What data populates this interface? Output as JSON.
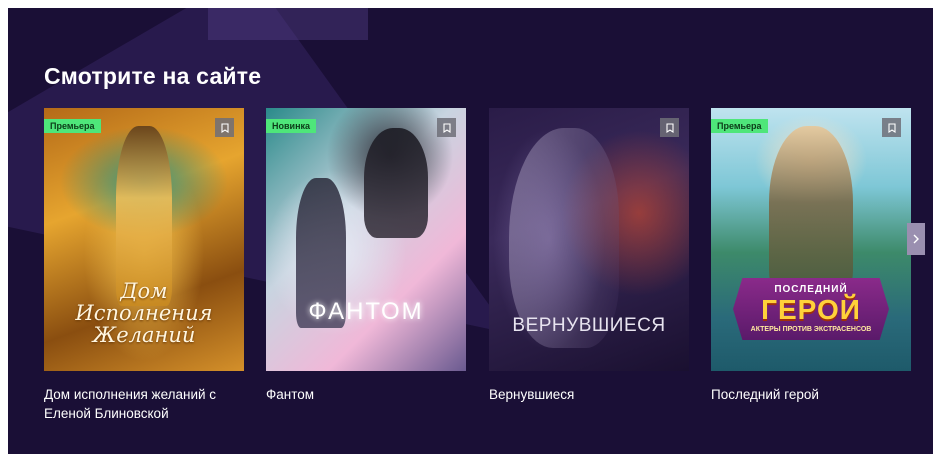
{
  "section": {
    "title": "Смотрите на сайте"
  },
  "cards": [
    {
      "badge": "Премьера",
      "poster_title": "Дом Исполнения Желаний",
      "caption": "Дом исполнения желаний с Еленой Блиновской"
    },
    {
      "badge": "Новинка",
      "poster_title": "ФАНТОМ",
      "caption": "Фантом"
    },
    {
      "poster_title": "ВЕРНУВШИЕСЯ",
      "caption": "Вернувшиеся"
    },
    {
      "badge": "Премьера",
      "poster_top": "ПОСЛЕДНИЙ",
      "poster_title": "ГЕРОЙ",
      "poster_subtitle": "АКТЕРЫ ПРОТИВ ЭКСТРАСЕНСОВ",
      "caption": "Последний герой"
    }
  ],
  "colors": {
    "background": "#1a0f36",
    "badge": "#4ee67a",
    "text": "#ffffff"
  },
  "icons": {
    "bookmark": "bookmark-icon",
    "next": "chevron-right-icon"
  }
}
